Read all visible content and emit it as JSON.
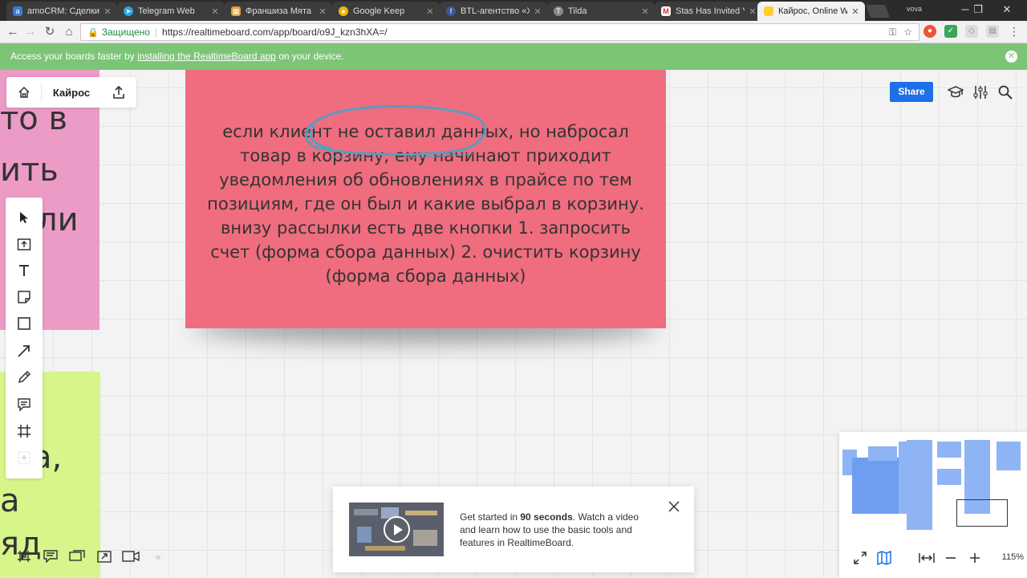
{
  "browser": {
    "tabs": [
      {
        "title": "amoCRM: Сделки",
        "favicon": "amocrm-icon",
        "color": "#3a7bd5",
        "glyph": "a"
      },
      {
        "title": "Telegram Web",
        "favicon": "telegram-icon",
        "color": "#2ca5e0",
        "glyph": "➤"
      },
      {
        "title": "Франшиза Мята L",
        "favicon": "franchise-icon",
        "color": "#e0a030",
        "glyph": "▦"
      },
      {
        "title": "Google Keep",
        "favicon": "keep-icon",
        "color": "#f5b400",
        "glyph": "●"
      },
      {
        "title": "BTL-агентство «Хо",
        "favicon": "facebook-icon",
        "color": "#3b5998",
        "glyph": "f"
      },
      {
        "title": "Tilda",
        "favicon": "tilda-icon",
        "color": "#888888",
        "glyph": "T"
      },
      {
        "title": "Stas Has Invited Yo",
        "favicon": "gmail-icon",
        "color": "#d93025",
        "glyph": "M"
      },
      {
        "title": "Кайрос, Online Wh",
        "favicon": "realtimeboard-icon",
        "color": "#ffd02f",
        "glyph": "■",
        "active": true
      }
    ],
    "window_label": "vova",
    "secure_label": "Защищено",
    "url": "https://realtimeboard.com/app/board/o9J_kzn3hXA=/",
    "url_host": "realtimeboard.com"
  },
  "banner": {
    "prefix": "Access your boards faster by ",
    "link": "installing the RealtimeBoard app",
    "suffix": " on your device."
  },
  "board": {
    "name": "Кайрос",
    "share_label": "Share",
    "left_note_fragments": [
      "то в",
      "ить",
      "ли"
    ],
    "green_note_fragments": [
      "а,",
      "а",
      "яд"
    ],
    "main_note_text": "если клиент не оставил данных, но набросал товар в корзину, ему начинают приходит уведомления об обновлениях в прайсе по тем позициям, где он был и какие выбрал в корзину. внизу рассылки есть две кнопки 1. запросить счет (форма сбора данных) 2. очистить корзину (форма сбора данных)",
    "colors": {
      "main_note": "#ef6d7e",
      "left_note": "#ec9bc6",
      "green_note": "#d6f58a",
      "accent": "#1e6fe8"
    }
  },
  "video_popup": {
    "text_pre": "Get started in ",
    "text_bold": "90 seconds",
    "text_post": ". Watch a video and learn how to use the basic tools and features in RealtimeBoard."
  },
  "minimap": {
    "zoom": "115%"
  }
}
